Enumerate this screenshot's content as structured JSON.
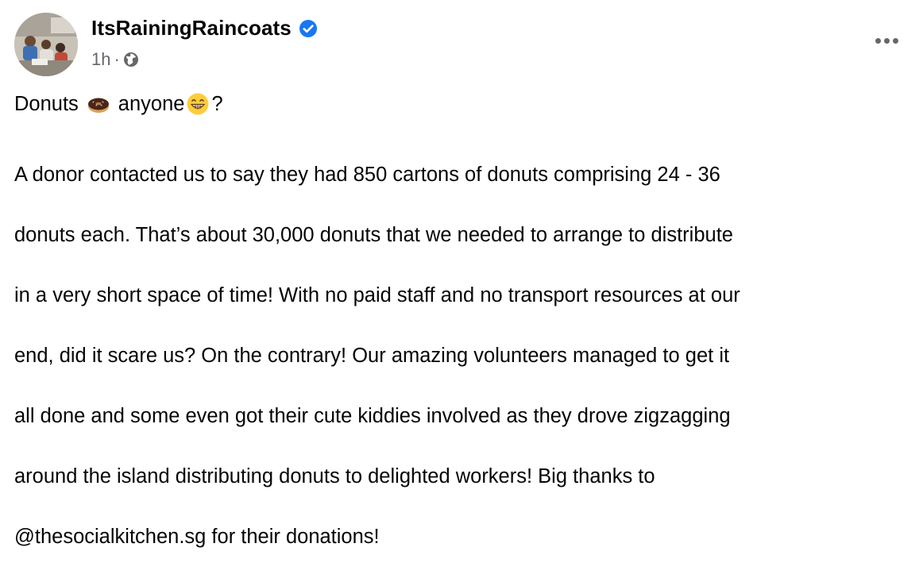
{
  "post": {
    "author": "ItsRainingRaincoats",
    "verified": true,
    "time": "1h",
    "separator": "·",
    "audience_icon": "globe-icon",
    "more_icon": "more-options-icon",
    "headline_start": "Donuts",
    "headline_emoji_1": "donut-emoji",
    "headline_middle": "anyone",
    "headline_emoji_2": "grinning-face-emoji",
    "headline_end": "?",
    "body_lines": [
      "A donor contacted us to say they had 850 cartons of donuts comprising 24 - 36",
      "donuts each. That’s about 30,000 donuts that we needed to arrange to distribute",
      "in a very short space of time! With no paid staff and no transport resources at our",
      "end, did it scare us? On the contrary! Our amazing volunteers managed to get it",
      "all done and some even got their cute kiddies involved as they drove zigzagging",
      "around the island distributing donuts to delighted workers! Big thanks to",
      "@thesocialkitchen.sg for their donations!"
    ]
  },
  "colors": {
    "text": "#050505",
    "secondary": "#65676b",
    "verified_blue": "#1877f2"
  }
}
